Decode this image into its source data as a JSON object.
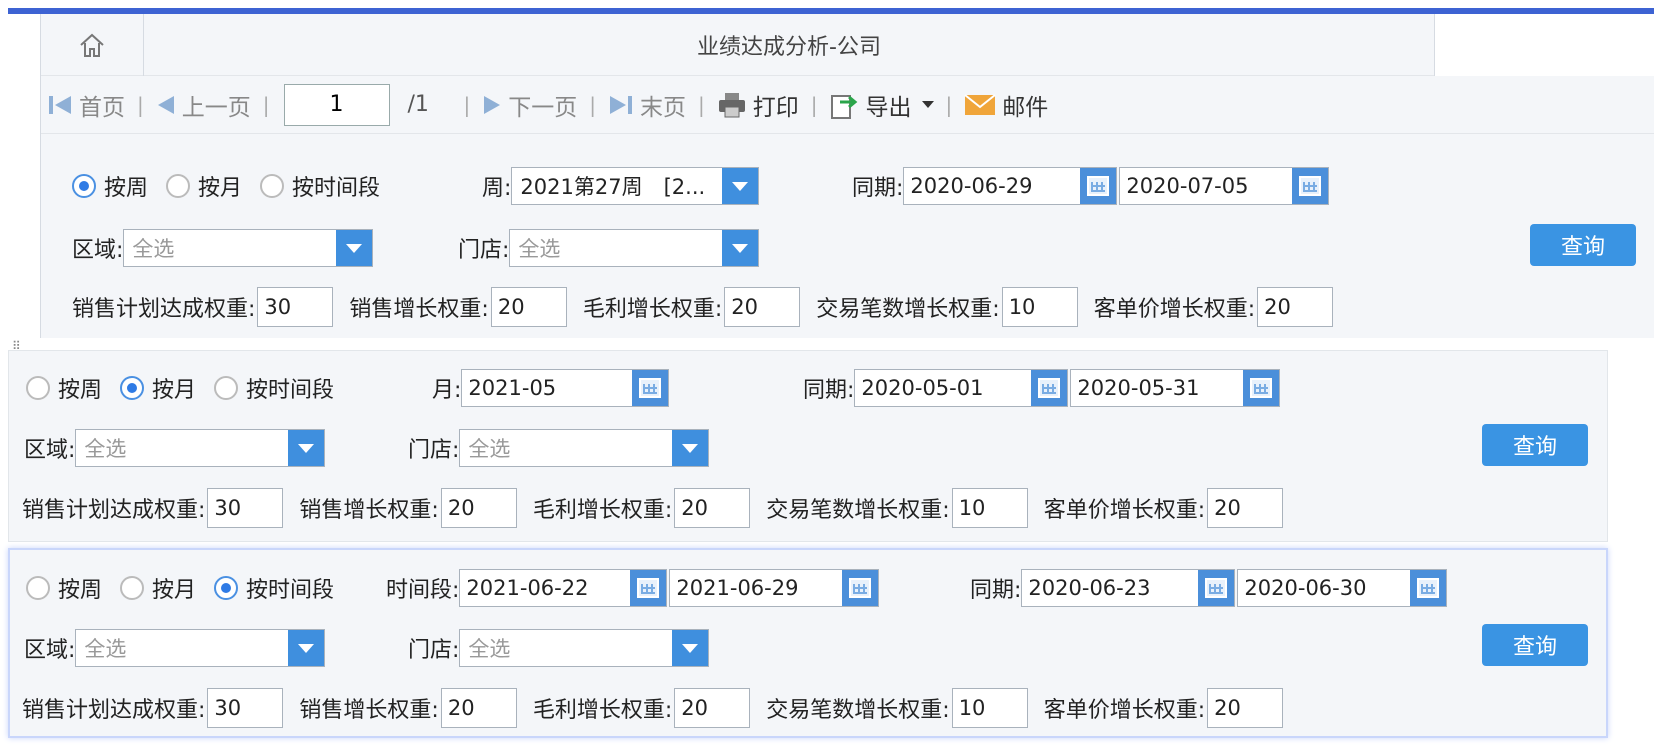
{
  "report": {
    "title": "业绩达成分析-公司",
    "toolbar": {
      "first": "首页",
      "prev": "上一页",
      "page_value": "1",
      "page_total": "/1",
      "next": "下一页",
      "last": "末页",
      "print": "打印",
      "export": "导出",
      "mail": "邮件",
      "separator": "|"
    }
  },
  "common": {
    "radio_week": "按周",
    "radio_month": "按月",
    "radio_range": "按时间段",
    "region_label": "区域:",
    "store_label": "门店:",
    "select_all": "全选",
    "same_period_label": "同期:",
    "query": "查询",
    "w_plan_label": "销售计划达成权重:",
    "w_sales_label": "销售增长权重:",
    "w_margin_label": "毛利增长权重:",
    "w_count_label": "交易笔数增长权重:",
    "w_price_label": "客单价增长权重:",
    "w_plan": "30",
    "w_sales": "20",
    "w_margin": "20",
    "w_count": "10",
    "w_price": "20"
  },
  "panel_week": {
    "selected": "week",
    "period_label": "周:",
    "period_value": "2021第27周　[2...",
    "same_start": "2020-06-29",
    "same_end": "2020-07-05"
  },
  "panel_month": {
    "selected": "month",
    "period_label": "月:",
    "period_value": "2021-05",
    "same_start": "2020-05-01",
    "same_end": "2020-05-31"
  },
  "panel_range": {
    "selected": "range",
    "period_label": "时间段:",
    "range_start": "2021-06-22",
    "range_end": "2021-06-29",
    "same_start": "2020-06-23",
    "same_end": "2020-06-30"
  },
  "colors": {
    "accent": "#3a94e3",
    "top_bar": "#3d63d3",
    "panel_bg": "#f4f6f9"
  }
}
